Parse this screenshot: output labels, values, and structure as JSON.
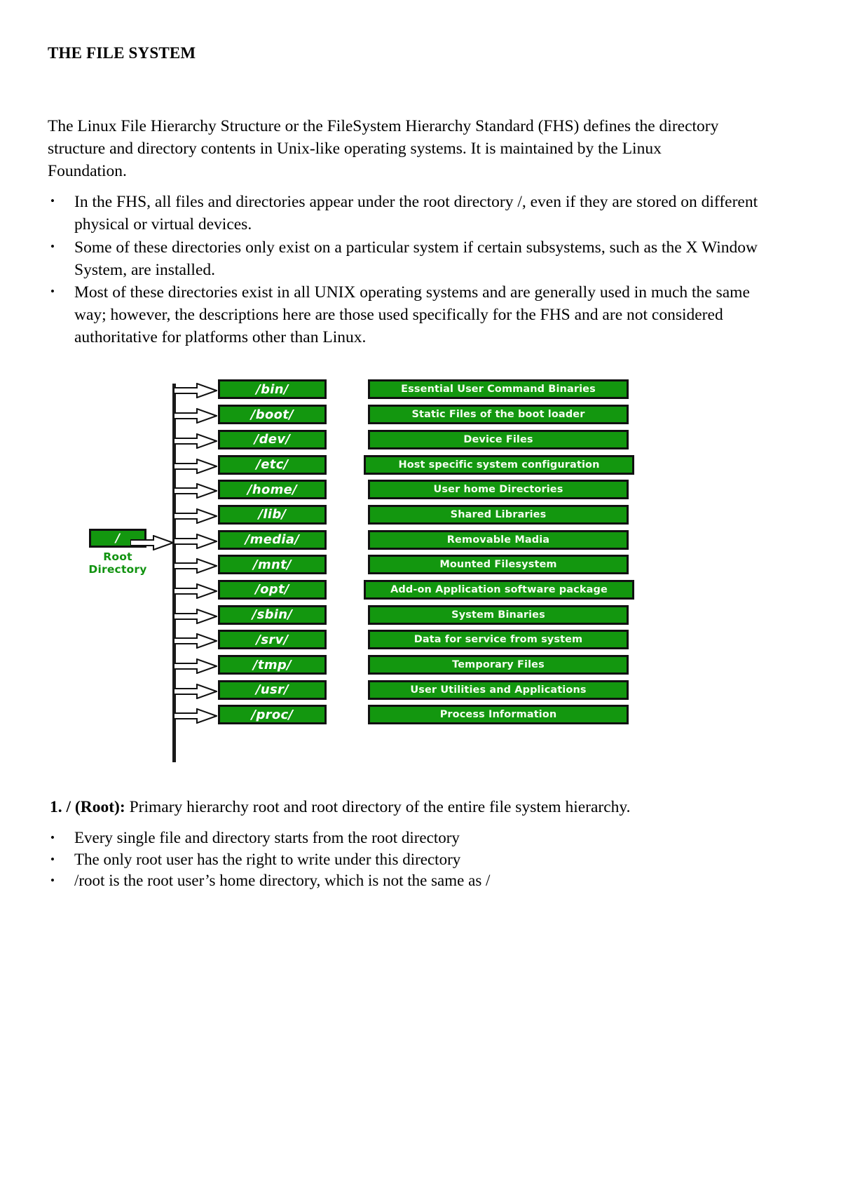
{
  "document": {
    "title": "THE FILE SYSTEM",
    "intro": "The Linux File Hierarchy Structure or the FileSystem Hierarchy Standard (FHS) defines the directory structure and directory contents in Unix-like operating systems. It is maintained by the Linux Foundation.",
    "intro_bullets": [
      "In the FHS, all files and directories appear under the root directory /, even if they are stored on different physical or virtual devices.",
      "Some of these directories only exist on a particular system if certain subsystems, such as the X Window System, are installed.",
      "Most of these directories exist in all UNIX operating systems and are generally used in much the same way; however, the descriptions here are those used specifically for the FHS and are not considered authoritative for platforms other than Linux."
    ],
    "section": {
      "number_label": "1. / (Root):",
      "text": " Primary hierarchy root and root directory of the entire file system hierarchy."
    },
    "section_bullets": [
      "Every single file and directory starts from the root directory",
      "The only root user has the right to write under this directory",
      "/root is the root user’s home directory, which is not the same as /"
    ]
  },
  "diagram": {
    "root_node": {
      "symbol": "/",
      "label_line1": "Root",
      "label_line2": "Directory"
    },
    "colors": {
      "box_fill": "#13970f",
      "box_border": "#111111",
      "box_text": "#ffffff",
      "root_label_text": "#119310",
      "trunk": "#1a1a1a",
      "arrow_fill": "#ffffff",
      "arrow_stroke": "#111111"
    },
    "rows": [
      {
        "dir": "/bin/",
        "desc": "Essential User Command Binaries"
      },
      {
        "dir": "/boot/",
        "desc": "Static Files of the boot loader"
      },
      {
        "dir": "/dev/",
        "desc": "Device Files"
      },
      {
        "dir": "/etc/",
        "desc": "Host specific system configuration"
      },
      {
        "dir": "/home/",
        "desc": "User home Directories"
      },
      {
        "dir": "/lib/",
        "desc": "Shared Libraries"
      },
      {
        "dir": "/media/",
        "desc": "Removable Madia"
      },
      {
        "dir": "/mnt/",
        "desc": "Mounted Filesystem"
      },
      {
        "dir": "/opt/",
        "desc": "Add-on Application software package"
      },
      {
        "dir": "/sbin/",
        "desc": "System Binaries"
      },
      {
        "dir": "/srv/",
        "desc": "Data for service from system"
      },
      {
        "dir": "/tmp/",
        "desc": "Temporary Files"
      },
      {
        "dir": "/usr/",
        "desc": "User Utilities and Applications"
      },
      {
        "dir": "/proc/",
        "desc": "Process Information"
      }
    ]
  }
}
